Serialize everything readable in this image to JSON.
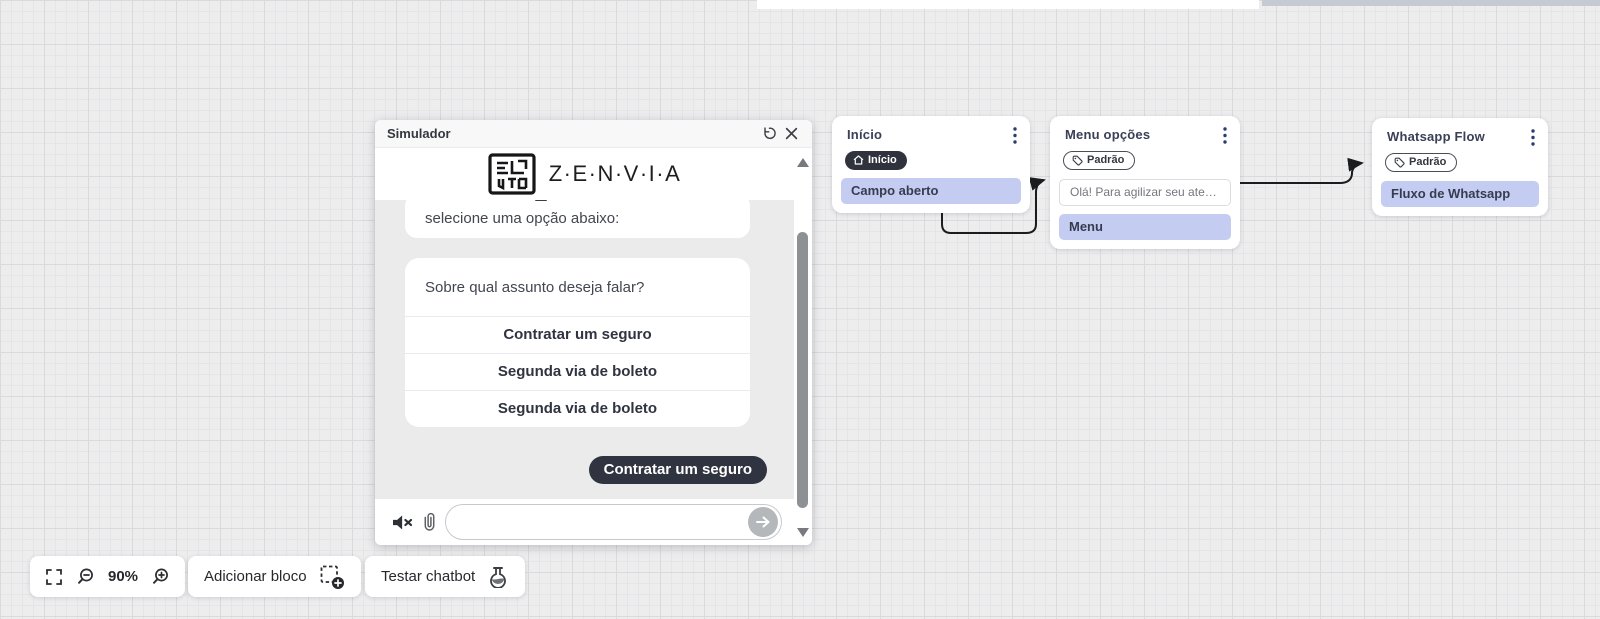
{
  "simulator": {
    "title": "Simulador",
    "brand_text": "Z·E·N·V·I·A",
    "scrolled_message": "selecione uma opção abaixo:",
    "question_card": {
      "question": "Sobre qual assunto deseja falar?",
      "options": [
        "Contratar um seguro",
        "Segunda via de boleto",
        "Segunda via de boleto"
      ]
    },
    "user_message": "Contratar um seguro",
    "input": {
      "value": "",
      "placeholder": ""
    }
  },
  "nodes": [
    {
      "title": "Início",
      "badge": "Início",
      "rows": [
        {
          "label": "Campo aberto"
        }
      ]
    },
    {
      "title": "Menu opções",
      "badge": "Padrão",
      "rows": [
        {
          "label": "Olá! Para agilizar seu atendime..."
        },
        {
          "label": "Menu"
        }
      ]
    },
    {
      "title": "Whatsapp Flow",
      "badge": "Padrão",
      "rows": [
        {
          "label": "Fluxo de Whatsapp"
        }
      ]
    }
  ],
  "toolbar": {
    "zoom_value": "90%",
    "add_block_label": "Adicionar bloco",
    "test_chatbot_label": "Testar chatbot"
  },
  "icons": {
    "simulator_header": [
      "reset-icon",
      "close-icon"
    ],
    "node": [
      "home-icon",
      "tag-icon",
      "kebab-menu-icon"
    ],
    "chat": [
      "mute-speaker-icon",
      "paperclip-icon",
      "send-icon"
    ],
    "toolbar": [
      "fit-screen-icon",
      "zoom-out-icon",
      "zoom-in-icon",
      "add-block-icon",
      "flask-icon"
    ]
  },
  "colors": {
    "canvas_bg": "#ededee",
    "node_row_highlight": "#c4cdf1",
    "badge_dark": "#30333d",
    "user_bubble": "#303440",
    "connector": "#1b1c1e",
    "chat_bg": "#ebebec"
  }
}
